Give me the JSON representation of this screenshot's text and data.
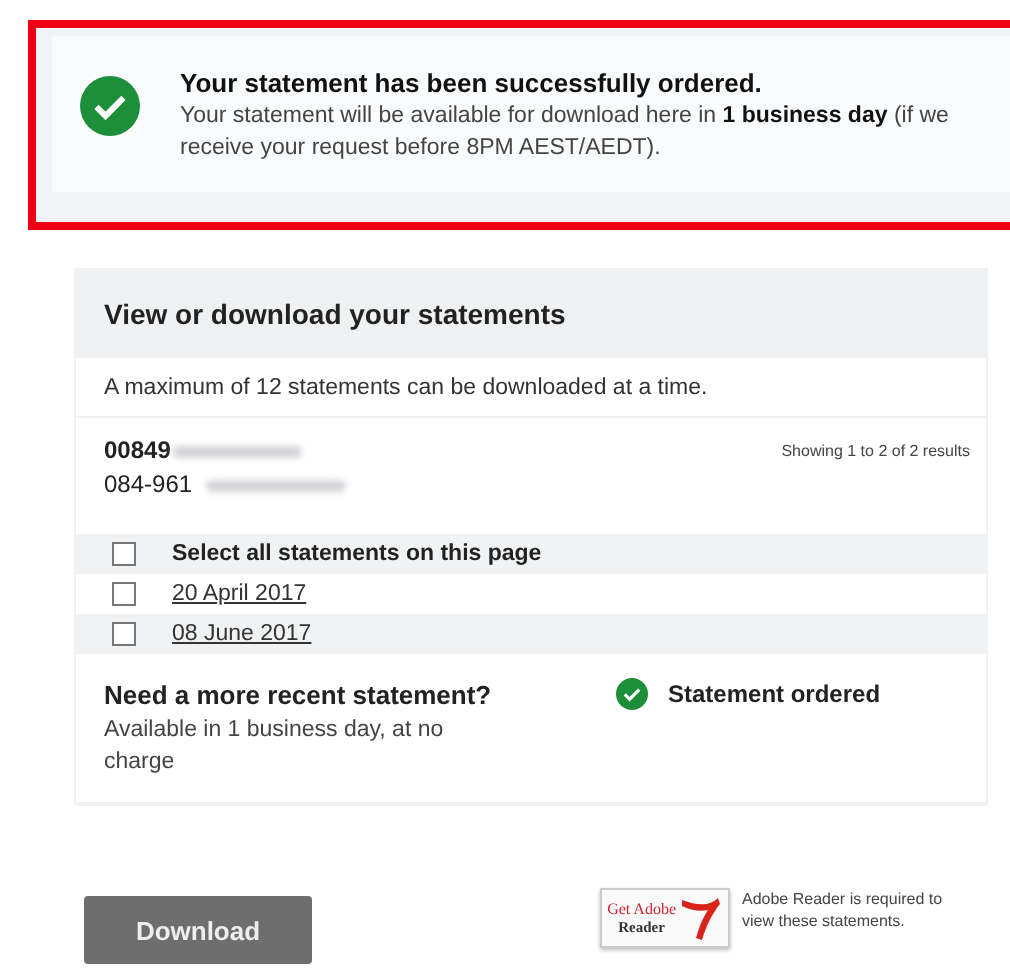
{
  "alert": {
    "kind": "success",
    "title": "Your statement has been successfully ordered.",
    "message": "Your statement will be available for download here in **1 business day** (if we receive your request before 8PM AEST/AEDT).",
    "highlighted": true
  },
  "statements_panel": {
    "heading": "View or download your statements",
    "note": "A maximum of 12 statements can be downloaded at a time.",
    "account": {
      "number": "00849",
      "number_redacted": true,
      "bsb": "084-961",
      "bsb_redacted": true
    },
    "results": "Showing 1 to 2 of 2 results",
    "select_all": {
      "label": "Select all statements on this page",
      "checked": false
    },
    "statements": [
      {
        "date": "20 April 2017",
        "checked": false
      },
      {
        "date": "08 June 2017",
        "checked": false
      }
    ],
    "recent": {
      "title": "Need a more recent statement?",
      "detail": "Available in 1 business day, at no charge",
      "status": "Statement ordered",
      "ordered": true
    }
  },
  "download_button": {
    "label": "Download",
    "disabled": true
  },
  "adobe": {
    "badge_top": "Get Adobe",
    "badge_bottom": "Reader",
    "note": "Adobe Reader is required to view these statements."
  }
}
